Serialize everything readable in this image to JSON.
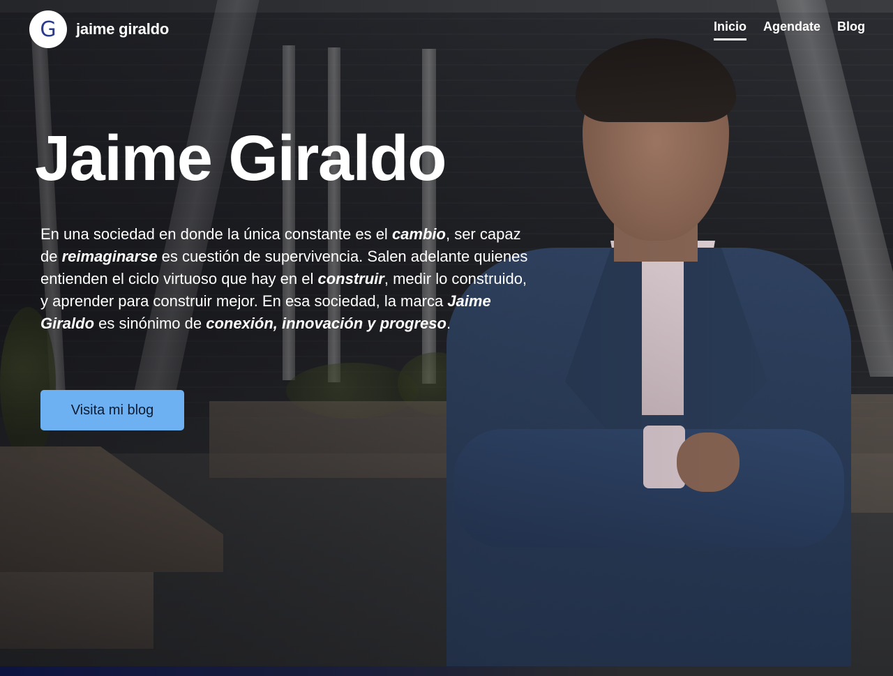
{
  "header": {
    "logo_letter": "G",
    "brand_name": "jaime giraldo",
    "nav": [
      {
        "label": "Inicio",
        "active": true
      },
      {
        "label": "Agendate",
        "active": false
      },
      {
        "label": "Blog",
        "active": false
      }
    ]
  },
  "hero": {
    "title": "Jaime Giraldo",
    "paragraph": {
      "p1": "En una sociedad en donde la única constante es el ",
      "e1": "cambio",
      "p2": ", ser capaz de ",
      "e2": "reimaginarse",
      "p3": " es cuestión de supervivencia. Salen adelante quienes entienden el ciclo virtuoso que hay en el ",
      "e3": "construir",
      "p4": ", medir lo construido, y aprender para construir mejor. En esa sociedad, la marca ",
      "e4": "Jaime Giraldo",
      "p5": " es sinónimo de ",
      "e5": "conexión, innovación y progreso",
      "p6": "."
    },
    "cta_label": "Visita mi blog"
  },
  "colors": {
    "cta_background": "#6db1f2",
    "text": "#ffffff",
    "logo_text": "#2a3a8c"
  },
  "icons": {
    "logo": "g-letter-logo-icon"
  }
}
